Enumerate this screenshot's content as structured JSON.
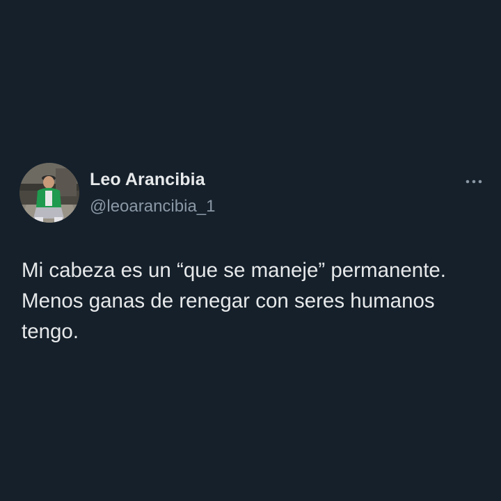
{
  "author": {
    "display_name": "Leo Arancibia",
    "handle": "@leoarancibia_1",
    "avatar_icon": "user-photo-avatar"
  },
  "more_icon": "more-options-icon",
  "tweet": {
    "lines": [
      "Mi cabeza es un “que se maneje” permanente.",
      "Menos ganas de renegar con seres humanos",
      "tengo."
    ]
  },
  "colors": {
    "background": "#15202b",
    "primary_text": "#e7e9ea",
    "secondary_text": "#8b98a5"
  }
}
